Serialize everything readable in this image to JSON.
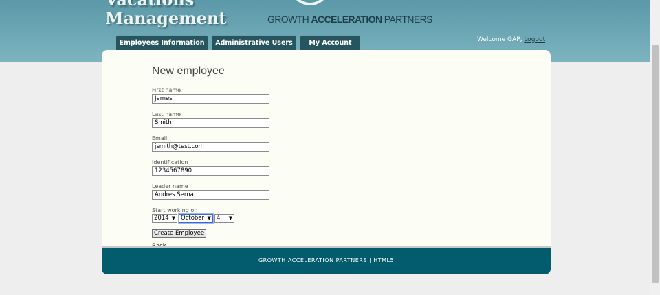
{
  "header": {
    "app_title_line1": "Vacations",
    "app_title_line2": "Management",
    "brand_light": "GROWTH ",
    "brand_bold": "ACCELERATION",
    "brand_end": " PARTNERS",
    "nav": [
      {
        "label": "Employees Information"
      },
      {
        "label": "Administrative Users"
      },
      {
        "label": "My Account"
      }
    ],
    "welcome_text": "Welcome GAP,",
    "logout_label": "Logout"
  },
  "form": {
    "title": "New employee",
    "first_name": {
      "label": "First name",
      "value": "James"
    },
    "last_name": {
      "label": "Last name",
      "value": "Smith"
    },
    "email": {
      "label": "Email",
      "value": "jsmith@test.com"
    },
    "identification": {
      "label": "Identification",
      "value": "1234567890"
    },
    "leader_name": {
      "label": "Leader name",
      "value": "Andres Serna"
    },
    "start": {
      "label": "Start working on",
      "year": "2014",
      "month": "October",
      "day": "4"
    },
    "submit_label": "Create Employee",
    "back_label": "Back"
  },
  "footer": {
    "text": "GROWTH ACCELERATION PARTNERS | HTML5"
  },
  "colors": {
    "header": "#6aa8b6",
    "nav_tab": "#27555f",
    "footer": "#025c6e",
    "card": "#fcfdf4"
  }
}
